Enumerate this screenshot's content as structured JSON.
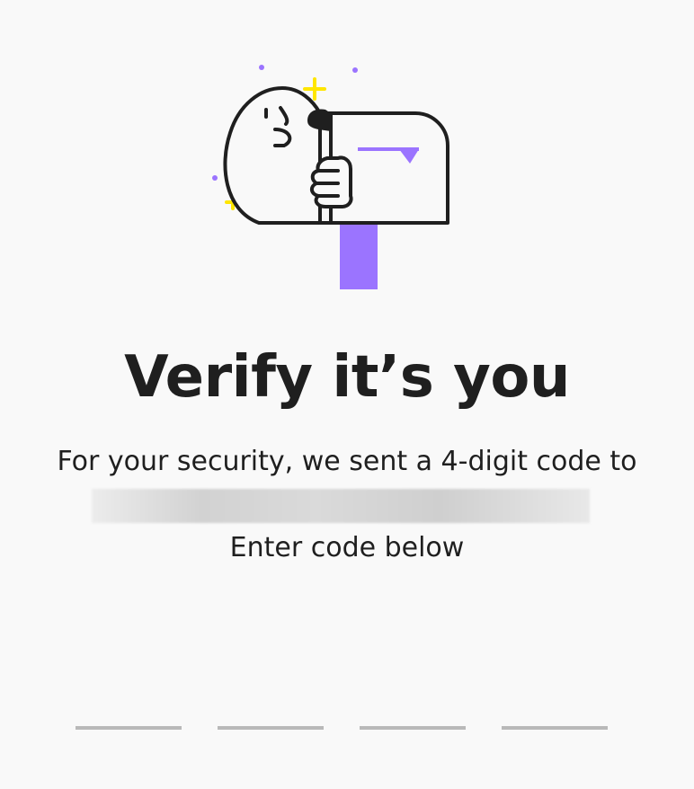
{
  "colors": {
    "accent_purple": "#9b74ff",
    "sparkle_yellow": "#ffe600",
    "ink": "#1f1f1f",
    "code_underline": "#b9b9b9",
    "background": "#f9f9f9"
  },
  "illustration": {
    "icon": "mailbox-character-icon"
  },
  "heading": {
    "title": "Verify it’s you"
  },
  "message": {
    "line1": "For your security, we sent a 4-digit code to",
    "redacted_contact": "",
    "instruction": "Enter code below"
  },
  "code_input": {
    "digits": [
      "",
      "",
      "",
      ""
    ]
  }
}
